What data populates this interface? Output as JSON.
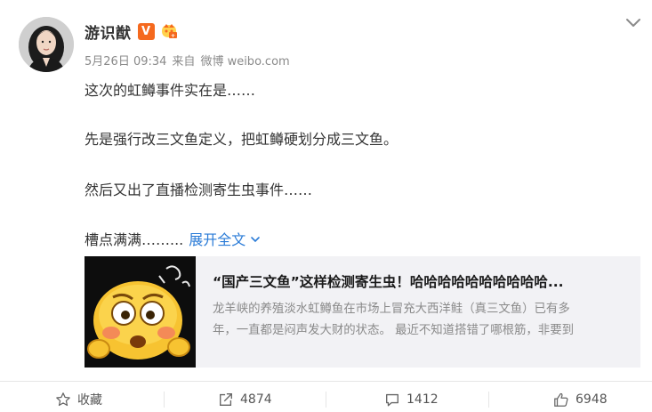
{
  "author": {
    "name": "游识猷",
    "verified_badge": "V",
    "avatar": "portrait-avatar"
  },
  "meta": {
    "time": "5月26日 09:34",
    "source_prefix": "来自",
    "source": "微博 weibo.com"
  },
  "post": {
    "lines": [
      "这次的虹鳟事件实在是……",
      "先是强行改三文鱼定义，把虹鳟硬划分成三文鱼。",
      "然后又出了直播检测寄生虫事件……",
      "槽点满满……..."
    ],
    "expand_label": "展开全文"
  },
  "link_card": {
    "title": "“国产三文鱼”这样检测寄生虫！哈哈哈哈哈哈哈哈哈哈...",
    "desc_line1": "龙羊峡的养殖淡水虹鳟鱼在市场上冒充大西洋鲑（真三文鱼）已有多",
    "desc_line2": "年，一直都是闷声发大财的状态。 最近不知道搭错了哪根筋，非要到",
    "thumbnail": "dizzy-emoji-face"
  },
  "actions": {
    "favorite": "收藏",
    "share_count": "4874",
    "comment_count": "1412",
    "like_count": "6948"
  },
  "colors": {
    "accent_link": "#2a7bd7",
    "verified_orange": "#f5691e",
    "card_bg": "#f2f2f5"
  }
}
